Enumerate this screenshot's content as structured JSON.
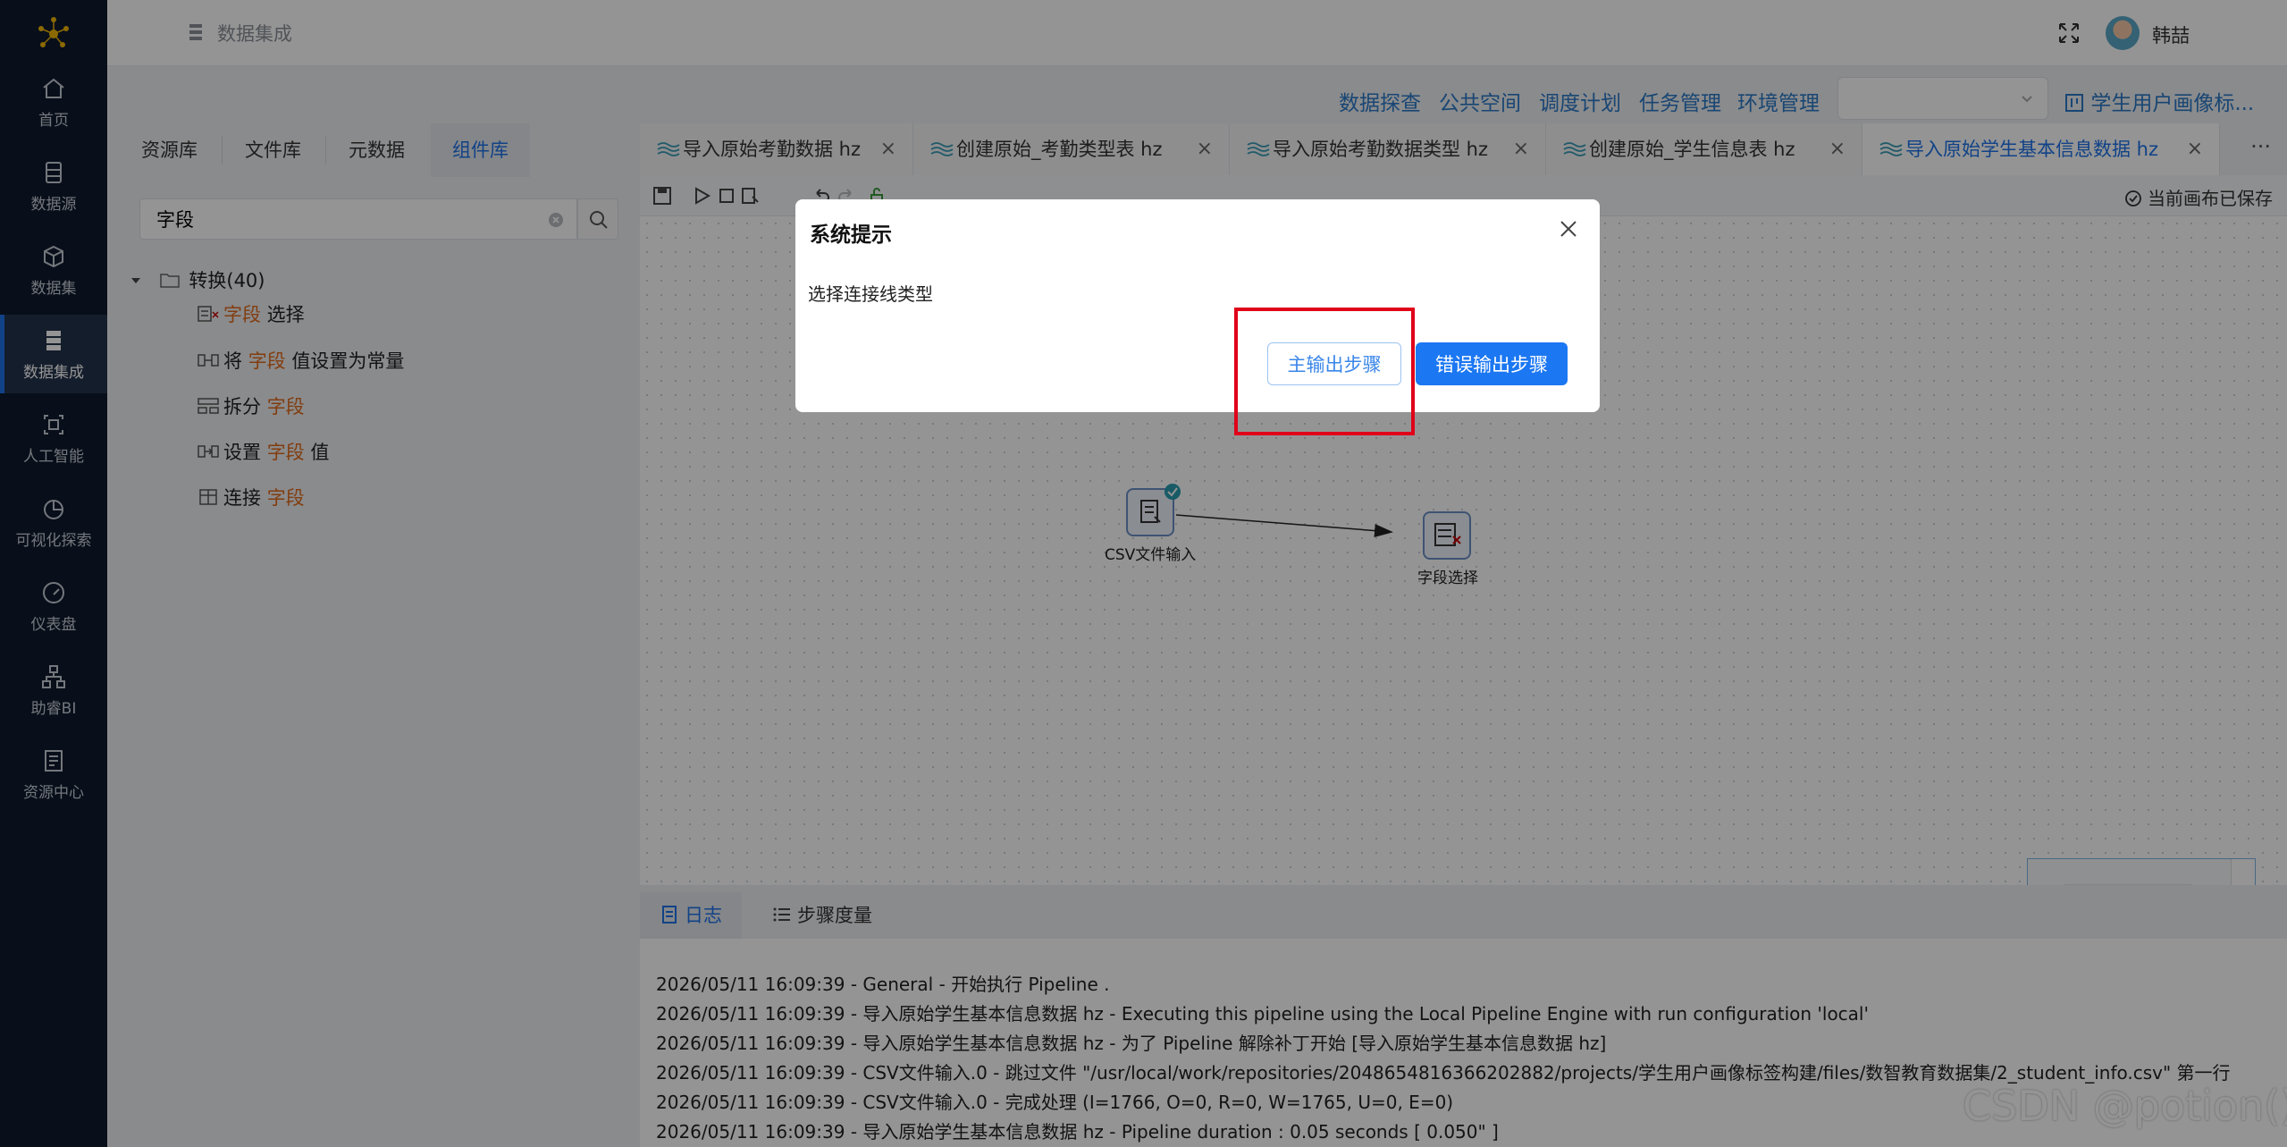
{
  "nav": {
    "items": [
      {
        "label": "首页",
        "icon": "home-icon"
      },
      {
        "label": "数据源",
        "icon": "database-icon"
      },
      {
        "label": "数据集",
        "icon": "cube-icon"
      },
      {
        "label": "数据集成",
        "icon": "server-icon"
      },
      {
        "label": "人工智能",
        "icon": "ai-icon"
      },
      {
        "label": "可视化探索",
        "icon": "pie-chart-icon"
      },
      {
        "label": "仪表盘",
        "icon": "gauge-icon"
      },
      {
        "label": "助睿BI",
        "icon": "org-chart-icon"
      },
      {
        "label": "资源中心",
        "icon": "document-icon"
      }
    ],
    "active_index": 3
  },
  "header": {
    "breadcrumb": "数据集成",
    "username": "韩喆"
  },
  "toplinks": [
    "数据探查",
    "公共空间",
    "调度计划",
    "任务管理",
    "环境管理"
  ],
  "project_select": {
    "value": ""
  },
  "profile_link": "学生用户画像标...",
  "panel": {
    "tabs": [
      "资源库",
      "文件库",
      "元数据",
      "组件库"
    ],
    "active_tab": 3,
    "search_value": "字段",
    "tree_root": "转换(40)",
    "tree_items": [
      {
        "pre": "",
        "hl": "字段",
        "post": " 选择"
      },
      {
        "pre": "将 ",
        "hl": "字段",
        "post": " 值设置为常量"
      },
      {
        "pre": "拆分 ",
        "hl": "字段",
        "post": ""
      },
      {
        "pre": "设置 ",
        "hl": "字段",
        "post": " 值"
      },
      {
        "pre": "连接 ",
        "hl": "字段",
        "post": ""
      }
    ]
  },
  "editor_tabs": [
    {
      "label": "导入原始考勤数据 hz",
      "active": false
    },
    {
      "label": "创建原始_考勤类型表 hz",
      "active": false
    },
    {
      "label": "导入原始考勤数据类型 hz",
      "active": false
    },
    {
      "label": "创建原始_学生信息表 hz",
      "active": false
    },
    {
      "label": "导入原始学生基本信息数据 hz",
      "active": true
    }
  ],
  "more_label": "···",
  "save_status": "当前画布已保存",
  "nodes": {
    "csv": "CSV文件输入",
    "select": "字段选择"
  },
  "log": {
    "tabs": [
      "日志",
      "步骤度量"
    ],
    "lines": [
      "2026/05/11 16:09:39 - General - 开始执行 Pipeline .",
      "2026/05/11 16:09:39 - 导入原始学生基本信息数据 hz - Executing this pipeline using the Local Pipeline Engine with run configuration 'local'",
      "2026/05/11 16:09:39 - 导入原始学生基本信息数据 hz - 为了 Pipeline 解除补丁开始 [导入原始学生基本信息数据 hz]",
      "2026/05/11 16:09:39 - CSV文件输入.0 - 跳过文件 \"/usr/local/work/repositories/2048654816366202882/projects/学生用户画像标签构建/files/数智教育数据集/2_student_info.csv\" 第一行",
      "2026/05/11 16:09:39 - CSV文件输入.0 - 完成处理 (I=1766, O=0, R=0, W=1765, U=0, E=0)",
      "2026/05/11 16:09:39 - 导入原始学生基本信息数据 hz - Pipeline duration : 0.05 seconds [  0.050\" ]"
    ]
  },
  "dialog": {
    "title": "系统提示",
    "message": "选择连接线类型",
    "main_button": "主输出步骤",
    "error_button": "错误输出步骤"
  },
  "watermark": "CSDN @potion()",
  "colors": {
    "accent": "#1e73e8",
    "highlight": "#e06a1b",
    "nav_bg": "#0f1b2d",
    "annotation": "#e0001a"
  }
}
